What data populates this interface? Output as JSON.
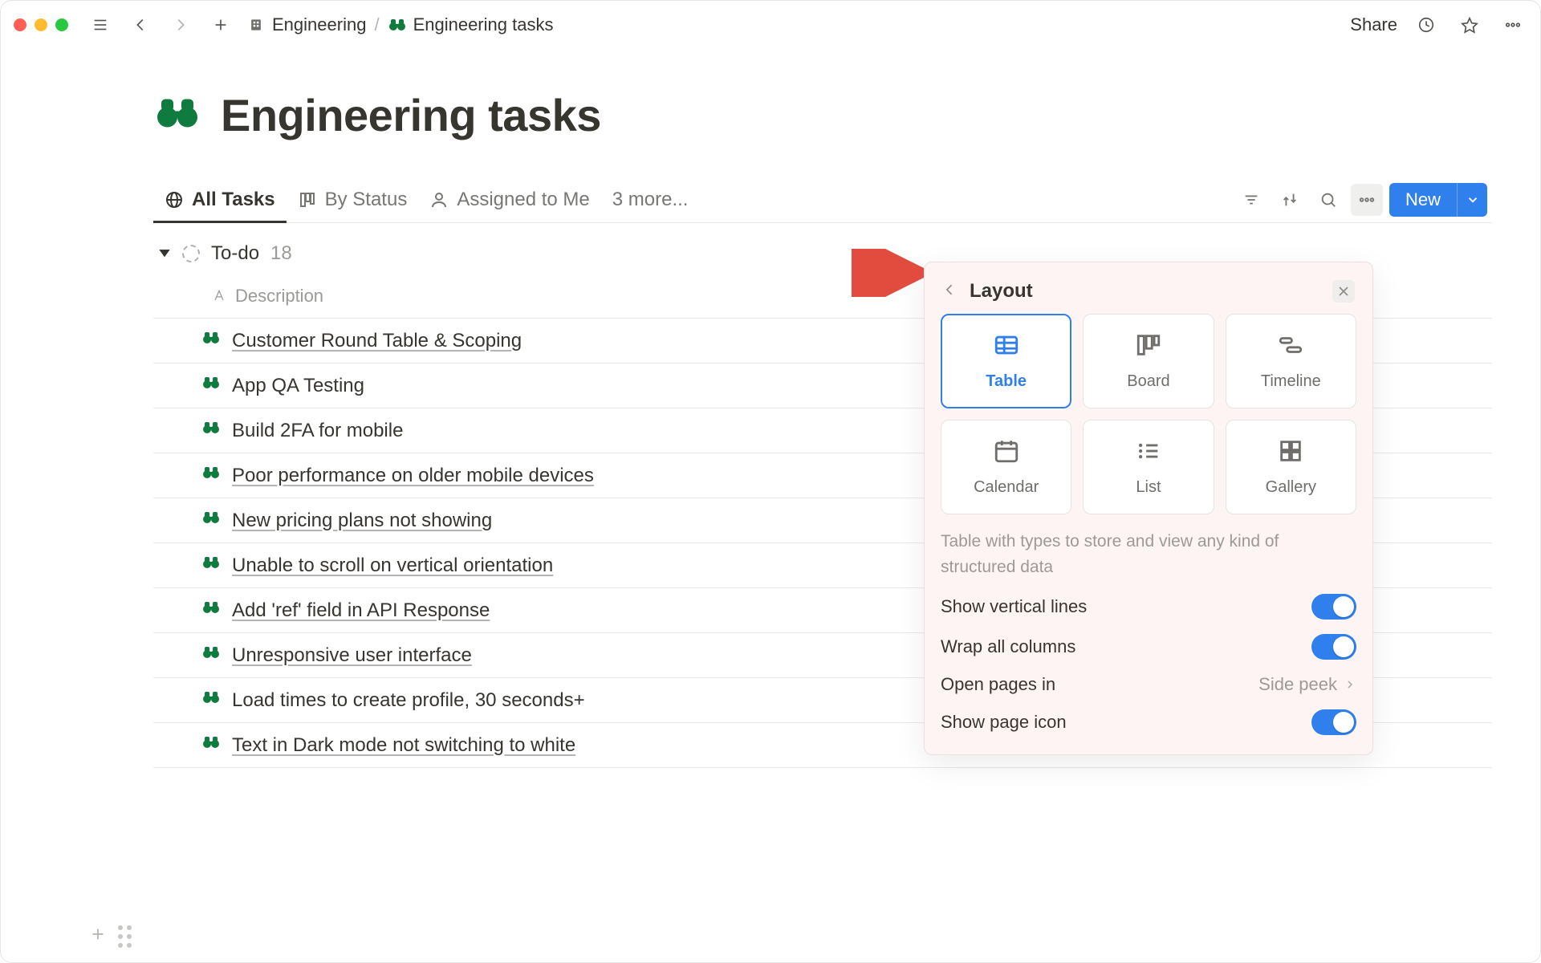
{
  "breadcrumb": {
    "parent": "Engineering",
    "current": "Engineering tasks"
  },
  "topbar": {
    "share": "Share"
  },
  "page": {
    "title": "Engineering tasks"
  },
  "views": {
    "tabs": [
      {
        "label": "All Tasks"
      },
      {
        "label": "By Status"
      },
      {
        "label": "Assigned to Me"
      }
    ],
    "more": "3 more...",
    "new_label": "New"
  },
  "group": {
    "name": "To-do",
    "count": "18"
  },
  "column": {
    "description": "Description"
  },
  "rows": [
    {
      "title": "Customer Round Table & Scoping"
    },
    {
      "title": "App QA Testing"
    },
    {
      "title": "Build 2FA for mobile"
    },
    {
      "title": "Poor performance on older mobile devices"
    },
    {
      "title": "New pricing plans not showing"
    },
    {
      "title": "Unable to scroll on vertical orientation"
    },
    {
      "title": "Add 'ref' field in API Response"
    },
    {
      "title": "Unresponsive user interface"
    },
    {
      "title": "Load times to create profile, 30 seconds+"
    },
    {
      "title": "Text in Dark mode not switching to white"
    }
  ],
  "popover": {
    "title": "Layout",
    "layouts": [
      {
        "label": "Table"
      },
      {
        "label": "Board"
      },
      {
        "label": "Timeline"
      },
      {
        "label": "Calendar"
      },
      {
        "label": "List"
      },
      {
        "label": "Gallery"
      }
    ],
    "desc": "Table with types to store and view any kind of structured data",
    "options": {
      "vertical_lines": "Show vertical lines",
      "wrap": "Wrap all columns",
      "open_in_label": "Open pages in",
      "open_in_value": "Side peek",
      "show_icon": "Show page icon"
    }
  }
}
